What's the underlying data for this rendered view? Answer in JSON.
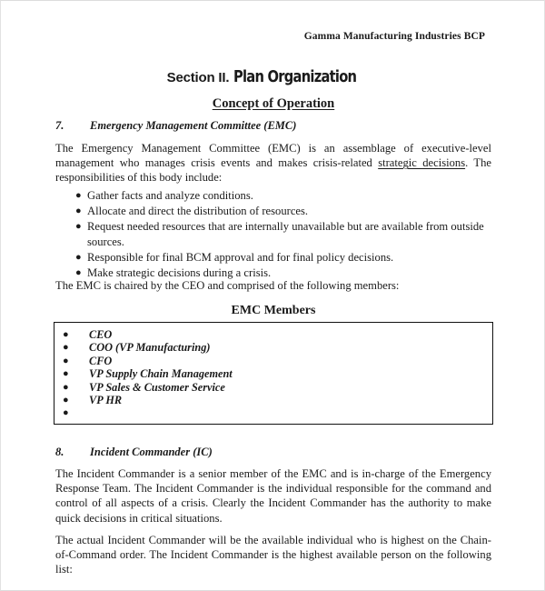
{
  "document": {
    "running_header": "Gamma Manufacturing Industries BCP",
    "section": {
      "label": "Section II.",
      "name": "Plan Organization"
    },
    "subsection_title": "Concept of Operation",
    "bullet_glyph": "●"
  },
  "emc": {
    "heading": {
      "number": "7.",
      "title": "Emergency Management Committee (EMC)"
    },
    "intro_before_link": "The Emergency Management Committee (EMC) is an assemblage of executive-level management who manages crisis events and makes crisis-related ",
    "intro_link": "strategic decisions",
    "intro_after_link": ".  The responsibilities of this body include:",
    "responsibilities": [
      "Gather facts and analyze conditions.",
      "Allocate and direct the distribution of resources.",
      "Request needed resources that are internally unavailable but are available from outside sources.",
      "Responsible for final BCM approval and for final policy decisions.",
      "Make strategic decisions during a crisis."
    ],
    "chaired_text": "The EMC is chaired by the CEO and comprised of the following members:",
    "members_box_title": "EMC Members",
    "members": [
      "CEO",
      "COO (VP Manufacturing)",
      "CFO",
      "VP Supply Chain Management",
      "VP Sales & Customer Service",
      "VP HR",
      ""
    ]
  },
  "incident_commander": {
    "heading": {
      "number": "8.",
      "title": "Incident Commander (IC)"
    },
    "paragraph_1": "The Incident Commander is a senior member of the EMC and is in-charge of the Emergency Response Team.  The Incident Commander is the individual responsible for the command and control of all aspects of a crisis.  Clearly the Incident Commander has the authority to make quick decisions in critical situations.",
    "paragraph_2": "The actual Incident Commander will be the available individual who is highest on the Chain-of-Command order.  The Incident Commander is the highest available person on the following list:"
  }
}
